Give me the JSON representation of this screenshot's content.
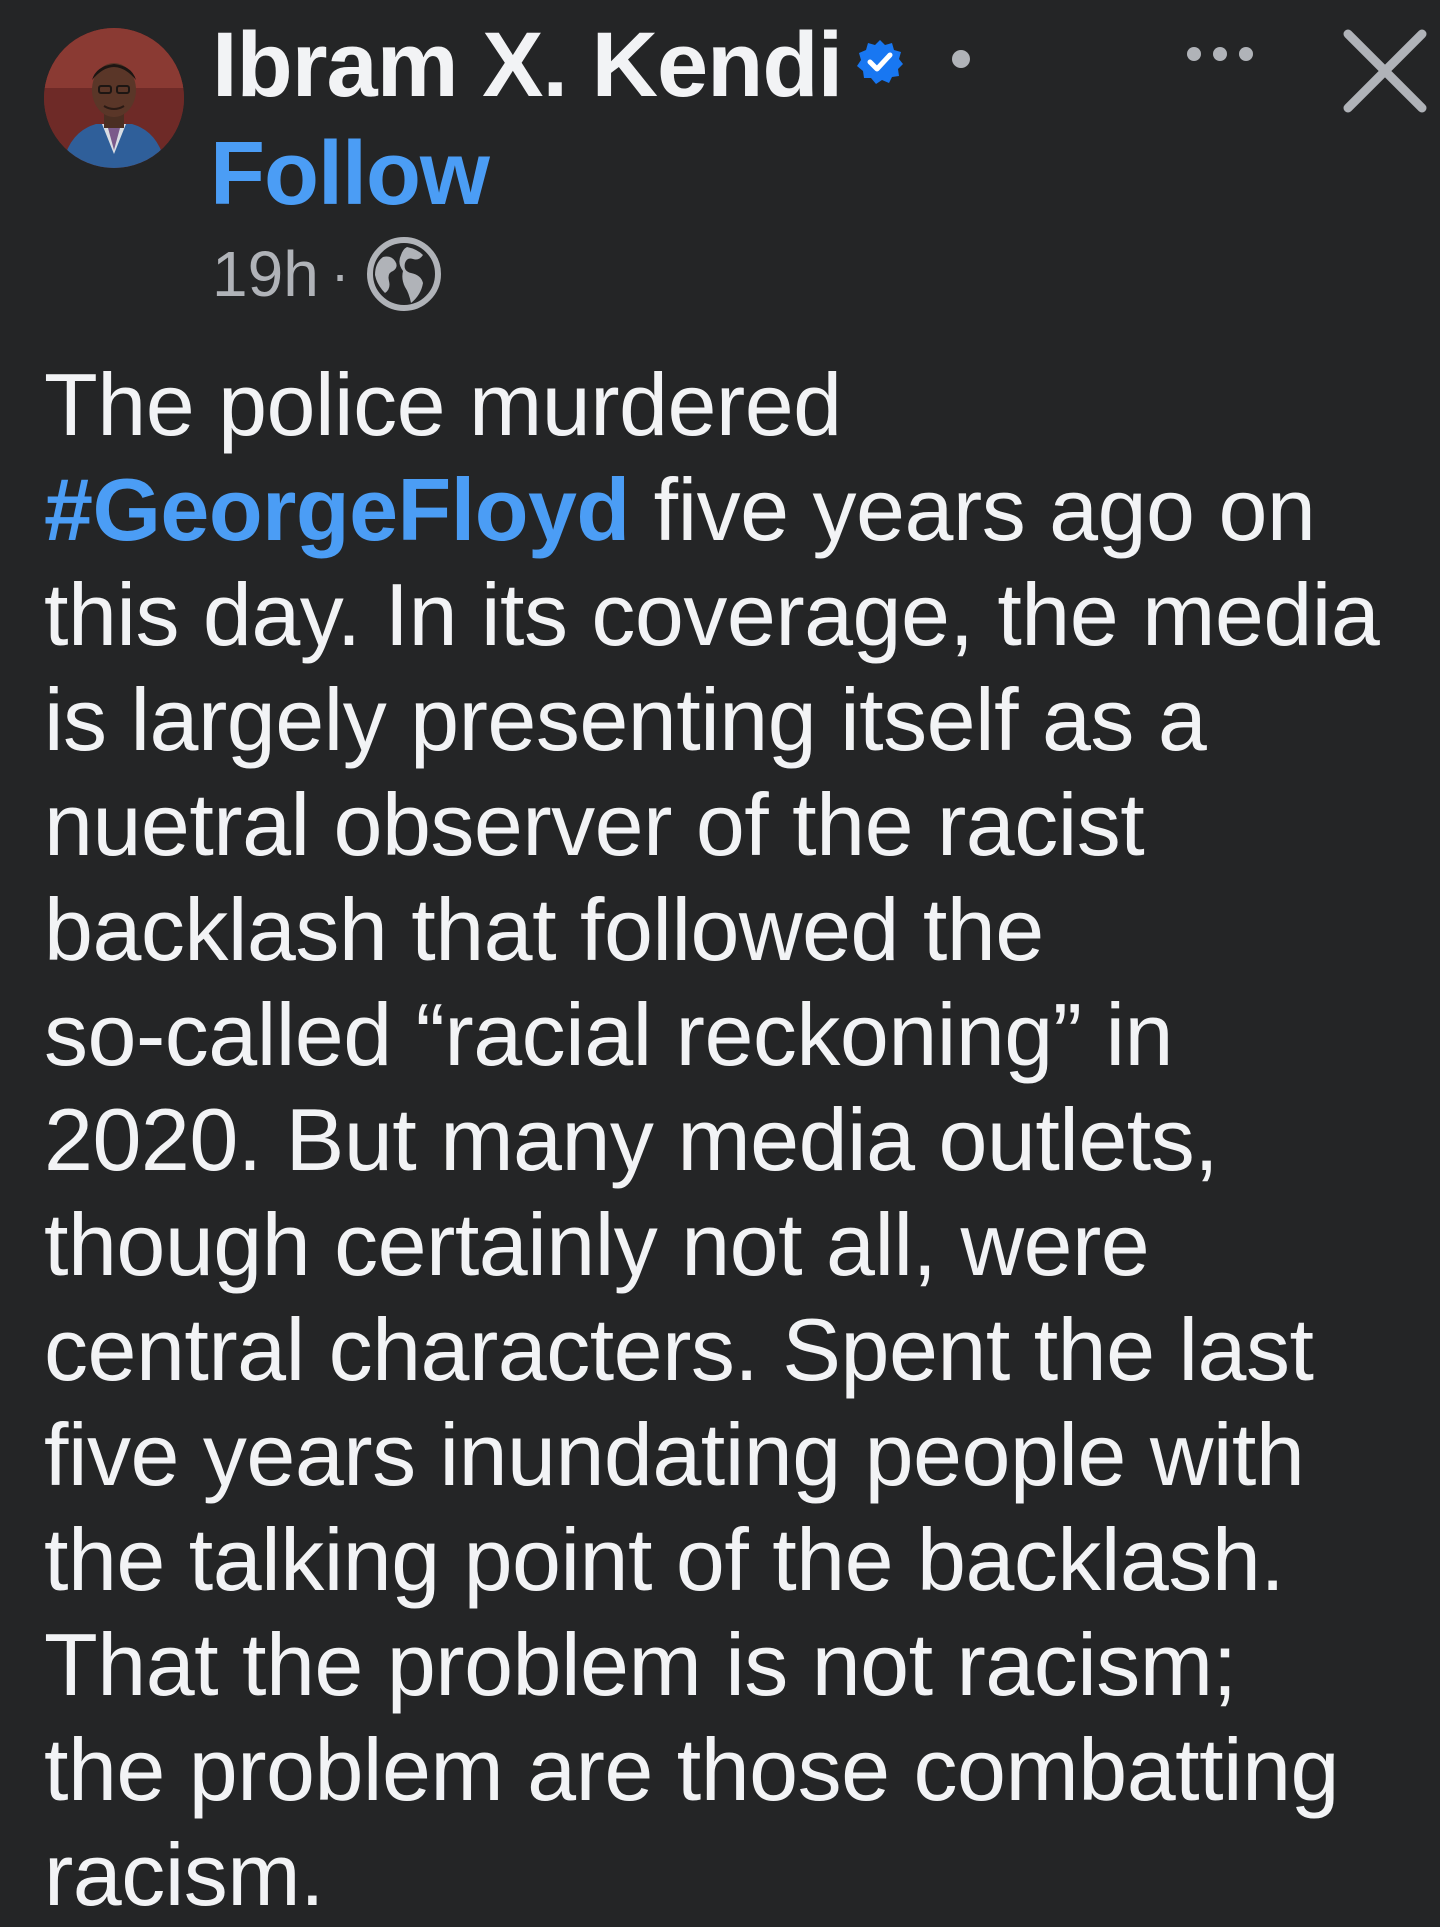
{
  "post": {
    "author": {
      "name": "Ibram X. Kendi",
      "verified": true,
      "follow_label": "Follow"
    },
    "meta": {
      "time": "19h",
      "separator": "·",
      "audience_icon": "globe-icon"
    },
    "actions": {
      "more_icon": "more-options-icon",
      "close_icon": "close-icon"
    },
    "body": {
      "lines": [
        {
          "text": "The police murdered"
        },
        {
          "hashtag": "#GeorgeFloyd",
          "text": " five years ago on"
        },
        {
          "text": "this day. In its coverage, the media"
        },
        {
          "text": "is largely presenting itself as a"
        },
        {
          "text": "nuetral observer of the racist"
        },
        {
          "text": "backlash that followed the"
        },
        {
          "text": "so-called “racial reckoning” in"
        },
        {
          "text": "2020. But many media outlets,"
        },
        {
          "text": "though certainly not all, were"
        },
        {
          "text": "central characters. Spent the last"
        },
        {
          "text": "five years inundating people with"
        },
        {
          "text": "the talking point of the backlash."
        },
        {
          "text": "That the problem is not racism;"
        },
        {
          "text": "the problem are those combatting"
        },
        {
          "text": "racism."
        }
      ]
    }
  },
  "colors": {
    "background": "#242526",
    "text": "#f2f3f5",
    "secondary_text": "#b0b3b8",
    "link": "#4b9df5",
    "verified_badge": "#1877f2"
  }
}
